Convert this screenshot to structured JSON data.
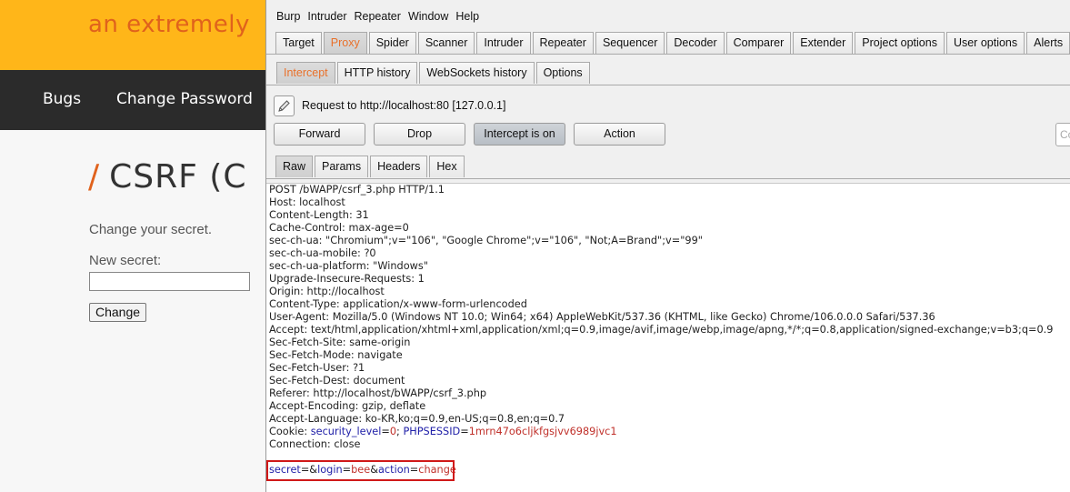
{
  "bwapp": {
    "tagline": "an extremely",
    "nav": [
      "Bugs",
      "Change Password"
    ],
    "title_slash": "/",
    "title": "CSRF (C",
    "intro": "Change your secret.",
    "new_secret_label": "New secret:",
    "change_button": "Change"
  },
  "burp": {
    "menu": [
      "Burp",
      "Intruder",
      "Repeater",
      "Window",
      "Help"
    ],
    "main_tabs": [
      "Target",
      "Proxy",
      "Spider",
      "Scanner",
      "Intruder",
      "Repeater",
      "Sequencer",
      "Decoder",
      "Comparer",
      "Extender",
      "Project options",
      "User options",
      "Alerts"
    ],
    "main_tab_active": "Proxy",
    "proxy_tabs": [
      "Intercept",
      "HTTP history",
      "WebSockets history",
      "Options"
    ],
    "proxy_tab_active": "Intercept",
    "request_label": "Request to http://localhost:80  [127.0.0.1]",
    "buttons": {
      "forward": "Forward",
      "drop": "Drop",
      "intercept": "Intercept is on",
      "action": "Action"
    },
    "search_placeholder": "Co",
    "view_tabs": [
      "Raw",
      "Params",
      "Headers",
      "Hex"
    ],
    "view_tab_active": "Raw",
    "request_lines": [
      "POST /bWAPP/csrf_3.php HTTP/1.1",
      "Host: localhost",
      "Content-Length: 31",
      "Cache-Control: max-age=0",
      "sec-ch-ua: \"Chromium\";v=\"106\", \"Google Chrome\";v=\"106\", \"Not;A=Brand\";v=\"99\"",
      "sec-ch-ua-mobile: ?0",
      "sec-ch-ua-platform: \"Windows\"",
      "Upgrade-Insecure-Requests: 1",
      "Origin: http://localhost",
      "Content-Type: application/x-www-form-urlencoded",
      "User-Agent: Mozilla/5.0 (Windows NT 10.0; Win64; x64) AppleWebKit/537.36 (KHTML, like Gecko) Chrome/106.0.0.0 Safari/537.36",
      "Accept: text/html,application/xhtml+xml,application/xml;q=0.9,image/avif,image/webp,image/apng,*/*;q=0.8,application/signed-exchange;v=b3;q=0.9",
      "Sec-Fetch-Site: same-origin",
      "Sec-Fetch-Mode: navigate",
      "Sec-Fetch-User: ?1",
      "Sec-Fetch-Dest: document",
      "Referer: http://localhost/bWAPP/csrf_3.php",
      "Accept-Encoding: gzip, deflate",
      "Accept-Language: ko-KR,ko;q=0.9,en-US;q=0.8,en;q=0.7"
    ],
    "cookie": {
      "prefix": "Cookie: ",
      "k1": "security_level",
      "eq1": "=",
      "v1": "0",
      "sep": "; ",
      "k2": "PHPSESSID",
      "eq2": "=",
      "v2": "1mrn47o6cljkfgsjvv6989jvc1"
    },
    "connection": "Connection: close",
    "body": {
      "k1": "secret",
      "eq1": "=",
      "amp1": "&",
      "k2": "login",
      "eq2": "=",
      "v2": "bee",
      "amp2": "&",
      "k3": "action",
      "eq3": "=",
      "v3": "change"
    },
    "colors": {
      "active_tab_text": "#e8702a",
      "param_name": "#2020a8",
      "param_value": "#c0302a",
      "highlight_border": "#d01818"
    }
  }
}
